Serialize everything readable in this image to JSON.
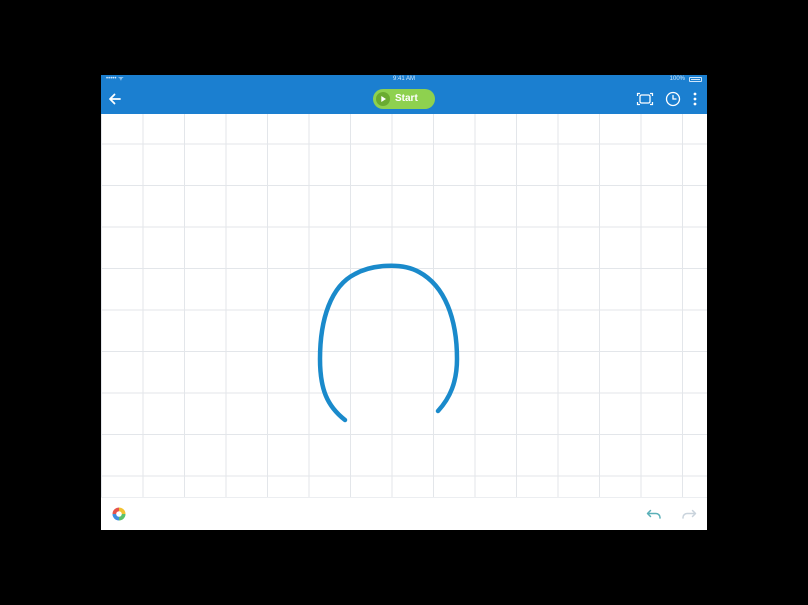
{
  "status_bar": {
    "carrier": "••••• ᯤ",
    "time": "9:41 AM",
    "battery": "100%"
  },
  "toolbar": {
    "back_icon": "back-arrow-icon",
    "start_label": "Start",
    "start_icon": "play-icon",
    "icon_a": "record-frame-icon",
    "icon_b": "clock-icon",
    "more_icon": "more-vertical-icon"
  },
  "canvas": {
    "background": "grid",
    "stroke_color": "#1a8acb"
  },
  "bottom_bar": {
    "palette_icon": "color-palette-icon",
    "undo_icon": "undo-icon",
    "redo_icon": "redo-icon"
  },
  "colors": {
    "app_bar": "#1b7fd0",
    "start_button": "#8ed14f",
    "stroke": "#1a8acb",
    "undo_active": "#5ab0b8",
    "redo_disabled": "#c9d3dc"
  }
}
